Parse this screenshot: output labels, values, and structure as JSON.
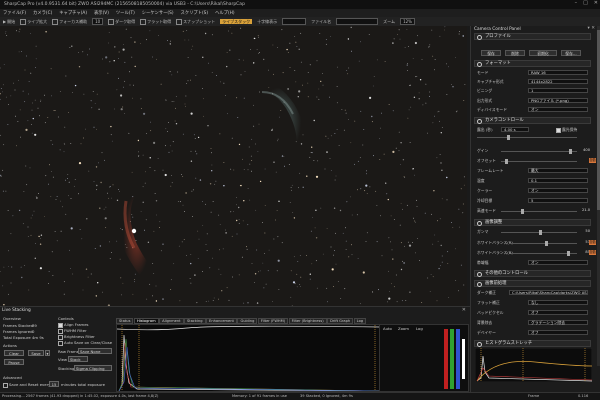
{
  "window": {
    "title": "SharpCap Pro (v4.0.9531.64 bit) ZWO ASI294MC (2156508185050004) via USB3 - C:\\Users\\Rikal\\SharpCap"
  },
  "menu": [
    "ファイル(F)",
    "カメラ(C)",
    "キャプチャ(A)",
    "表示(V)",
    "ツール(T)",
    "シーケンサー(S)",
    "スクリプト(S)",
    "ヘルプ(H)"
  ],
  "toolbar": {
    "items": [
      "開始",
      "ライブ拡大",
      "フォーカス補助",
      "10",
      "ダーク取得",
      "フラット取得",
      "スナップショット"
    ],
    "live_stack_btn": "ライブスタック",
    "overlay_label": "十字線表示",
    "filename_label": "ファイル名",
    "zoom_label": "ズーム",
    "zoom_value": "12%"
  },
  "panel": {
    "title": "Camera Control Panel",
    "profile": {
      "header": "プロファイル",
      "btn1": "保存",
      "btn2": "削除",
      "btn3": "初期化",
      "btn4": "保存…"
    },
    "format": {
      "header": "フォーマット",
      "rows": [
        {
          "label": "モード",
          "value": "RAW 16"
        },
        {
          "label": "キャプチャ形式",
          "value": "4144x2822"
        },
        {
          "label": "ビニング",
          "value": "1"
        },
        {
          "label": "出力形式",
          "value": "PNGファイル (*.png)"
        },
        {
          "label": "ディバイスモード",
          "value": "オン"
        }
      ]
    },
    "camera_controls": {
      "header": "カメラコントロール",
      "exposure_label": "露出 (秒)",
      "exposure_value": "4.00 s",
      "exposure_check": "露光保持",
      "gain_label": "ゲイン",
      "gain_value": "400",
      "rows": [
        {
          "label": "オフセット",
          "value": ""
        },
        {
          "label": "フレームレート",
          "value": "最大"
        },
        {
          "label": "温度",
          "value": "0.1"
        },
        {
          "label": "クーラー",
          "value": "オン"
        },
        {
          "label": "冷却目標",
          "value": "5"
        },
        {
          "label": "高速モード",
          "value": "オフ"
        }
      ],
      "temp_reading": "21.0"
    },
    "image_controls": {
      "header": "画像調整",
      "gamma_label": "ガンマ",
      "gamma_value": "50",
      "wb_red_label": "ホワイトバランス(R)",
      "wb_red_value": "53",
      "wb_blue_label": "ホワイトバランス(B)",
      "wb_blue_value": "85",
      "auto_label": "自動",
      "bandwidth_label": "帯域幅",
      "bandwidth_value": "オン"
    },
    "misc_header": "その他のコントロール",
    "preprocess": {
      "header": "画像前処理",
      "rows": [
        {
          "label": "ダーク補正",
          "value": "C:\\Users\\Rikal\\SharpCap\\darks\\ZWO ASI294MC..."
        },
        {
          "label": "フラット補正",
          "value": "なし"
        },
        {
          "label": "バッドピクセル",
          "value": "オフ"
        },
        {
          "label": "背景除去",
          "value": "グラデーション除去"
        },
        {
          "label": "デベイヤー",
          "value": "オフ"
        }
      ]
    },
    "histogram_header": "ヒストグラムストレッチ",
    "frame_label": "Frame",
    "frame_value": "0.116"
  },
  "live": {
    "title": "Live Stacking",
    "overview_label": "Overview",
    "stats": [
      {
        "label": "Frames Stacked",
        "value": "39"
      },
      {
        "label": "Frames Ignored",
        "value": "0"
      },
      {
        "label": "Total Exposure",
        "value": "4m 9s"
      }
    ],
    "actions_label": "Actions",
    "clear_btn": "Clear",
    "save_btn": "Save",
    "pause_btn": "Pause",
    "advanced_label": "Advanced",
    "save_reset_label": "Save and Reset every",
    "save_reset_num": "15",
    "save_reset_suffix": "minutes total exposure",
    "controls_label": "Controls",
    "controls": [
      {
        "label": "Align Frames",
        "on": true
      },
      {
        "label": "FWHM Filter",
        "on": false
      },
      {
        "label": "Brightness Filter",
        "on": false
      },
      {
        "label": "Auto Save on Clear/Close",
        "on": false
      }
    ],
    "raw_frames_label": "Raw Frames",
    "raw_frames_value": "Save None",
    "view_label": "View",
    "view_value": "Stack",
    "stacking_label": "Stacking",
    "stacking_value": "Sigma Clipping",
    "tabs": [
      "Status",
      "Histogram",
      "Alignment",
      "Stacking",
      "Enhancement",
      "Guiding",
      "Filter (FWHM)",
      "Filter (Brightness)",
      "Drift Graph",
      "Log"
    ],
    "active_tab": "Histogram",
    "histo_opts": [
      "Auto",
      "Zoom",
      "Log"
    ]
  },
  "status": {
    "left": "Processing... 2567 frames (41.93 dropped) in 1:45.02, exposure 4.0s, last frame 4,8(Z)",
    "middle": "Memory: 1 of 91 frames in use",
    "right": "39 Stacked, 0 Ignored, 4m 9s"
  },
  "colors": {
    "accent": "#d9a13a",
    "nebula_red": "#a43a2a",
    "nebula_cyan": "#6c9a98"
  }
}
